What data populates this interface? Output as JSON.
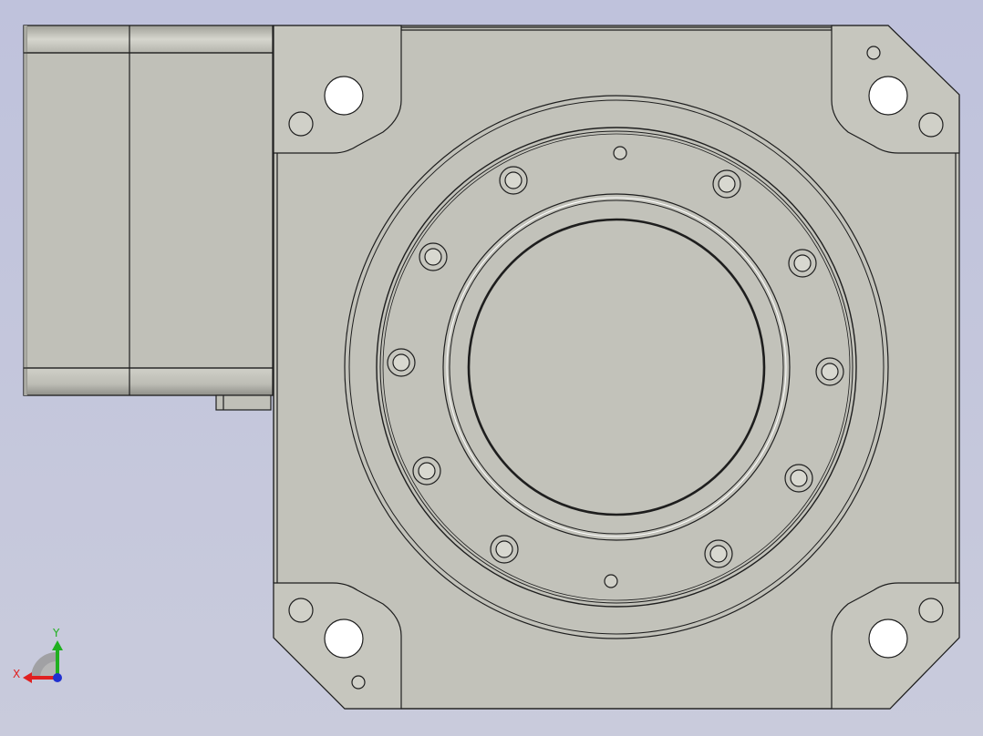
{
  "viewport": {
    "background_top": "#c0c3dc",
    "background_bottom": "#c8cadc",
    "part_fill": "#c2c2ba",
    "part_edge": "#1e1e1e",
    "motor_fill": "#c0c0b8"
  },
  "triad": {
    "x_label": "X",
    "y_label": "Y",
    "x_color": "#e02020",
    "y_color": "#20b020",
    "z_color": "#2030d0"
  }
}
